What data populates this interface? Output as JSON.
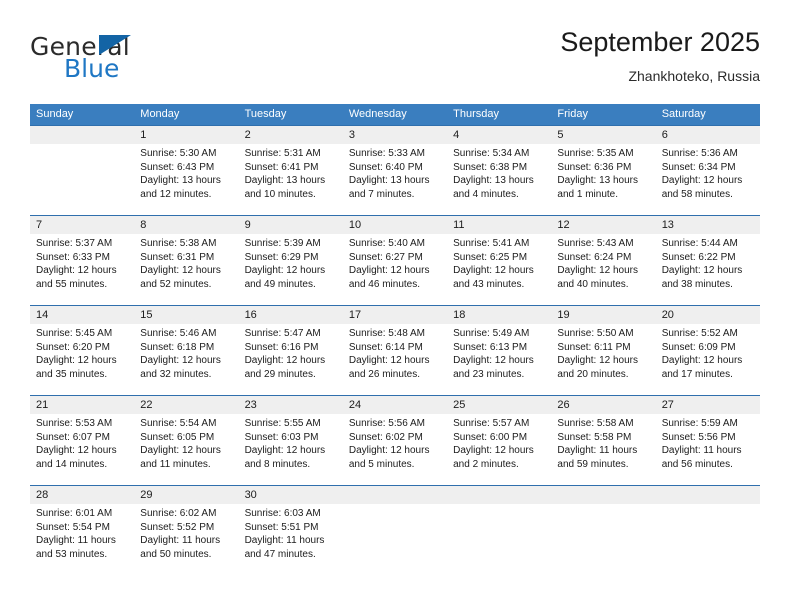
{
  "brand": {
    "name_part1": "General",
    "name_part2": "Blue",
    "triangle_color": "#1364a5",
    "blue_color": "#1f77c4"
  },
  "header": {
    "title": "September 2025",
    "subtitle": "Zhankhoteko, Russia"
  },
  "theme": {
    "header_blue": "#3a7ebf",
    "rule_blue": "#2f6fad",
    "band_gray": "#efefef"
  },
  "weekdays": [
    "Sunday",
    "Monday",
    "Tuesday",
    "Wednesday",
    "Thursday",
    "Friday",
    "Saturday"
  ],
  "weeks": [
    [
      {
        "day": "",
        "sunrise": "",
        "sunset": "",
        "daylight1": "",
        "daylight2": ""
      },
      {
        "day": "1",
        "sunrise": "Sunrise: 5:30 AM",
        "sunset": "Sunset: 6:43 PM",
        "daylight1": "Daylight: 13 hours",
        "daylight2": "and 12 minutes."
      },
      {
        "day": "2",
        "sunrise": "Sunrise: 5:31 AM",
        "sunset": "Sunset: 6:41 PM",
        "daylight1": "Daylight: 13 hours",
        "daylight2": "and 10 minutes."
      },
      {
        "day": "3",
        "sunrise": "Sunrise: 5:33 AM",
        "sunset": "Sunset: 6:40 PM",
        "daylight1": "Daylight: 13 hours",
        "daylight2": "and 7 minutes."
      },
      {
        "day": "4",
        "sunrise": "Sunrise: 5:34 AM",
        "sunset": "Sunset: 6:38 PM",
        "daylight1": "Daylight: 13 hours",
        "daylight2": "and 4 minutes."
      },
      {
        "day": "5",
        "sunrise": "Sunrise: 5:35 AM",
        "sunset": "Sunset: 6:36 PM",
        "daylight1": "Daylight: 13 hours",
        "daylight2": "and 1 minute."
      },
      {
        "day": "6",
        "sunrise": "Sunrise: 5:36 AM",
        "sunset": "Sunset: 6:34 PM",
        "daylight1": "Daylight: 12 hours",
        "daylight2": "and 58 minutes."
      }
    ],
    [
      {
        "day": "7",
        "sunrise": "Sunrise: 5:37 AM",
        "sunset": "Sunset: 6:33 PM",
        "daylight1": "Daylight: 12 hours",
        "daylight2": "and 55 minutes."
      },
      {
        "day": "8",
        "sunrise": "Sunrise: 5:38 AM",
        "sunset": "Sunset: 6:31 PM",
        "daylight1": "Daylight: 12 hours",
        "daylight2": "and 52 minutes."
      },
      {
        "day": "9",
        "sunrise": "Sunrise: 5:39 AM",
        "sunset": "Sunset: 6:29 PM",
        "daylight1": "Daylight: 12 hours",
        "daylight2": "and 49 minutes."
      },
      {
        "day": "10",
        "sunrise": "Sunrise: 5:40 AM",
        "sunset": "Sunset: 6:27 PM",
        "daylight1": "Daylight: 12 hours",
        "daylight2": "and 46 minutes."
      },
      {
        "day": "11",
        "sunrise": "Sunrise: 5:41 AM",
        "sunset": "Sunset: 6:25 PM",
        "daylight1": "Daylight: 12 hours",
        "daylight2": "and 43 minutes."
      },
      {
        "day": "12",
        "sunrise": "Sunrise: 5:43 AM",
        "sunset": "Sunset: 6:24 PM",
        "daylight1": "Daylight: 12 hours",
        "daylight2": "and 40 minutes."
      },
      {
        "day": "13",
        "sunrise": "Sunrise: 5:44 AM",
        "sunset": "Sunset: 6:22 PM",
        "daylight1": "Daylight: 12 hours",
        "daylight2": "and 38 minutes."
      }
    ],
    [
      {
        "day": "14",
        "sunrise": "Sunrise: 5:45 AM",
        "sunset": "Sunset: 6:20 PM",
        "daylight1": "Daylight: 12 hours",
        "daylight2": "and 35 minutes."
      },
      {
        "day": "15",
        "sunrise": "Sunrise: 5:46 AM",
        "sunset": "Sunset: 6:18 PM",
        "daylight1": "Daylight: 12 hours",
        "daylight2": "and 32 minutes."
      },
      {
        "day": "16",
        "sunrise": "Sunrise: 5:47 AM",
        "sunset": "Sunset: 6:16 PM",
        "daylight1": "Daylight: 12 hours",
        "daylight2": "and 29 minutes."
      },
      {
        "day": "17",
        "sunrise": "Sunrise: 5:48 AM",
        "sunset": "Sunset: 6:14 PM",
        "daylight1": "Daylight: 12 hours",
        "daylight2": "and 26 minutes."
      },
      {
        "day": "18",
        "sunrise": "Sunrise: 5:49 AM",
        "sunset": "Sunset: 6:13 PM",
        "daylight1": "Daylight: 12 hours",
        "daylight2": "and 23 minutes."
      },
      {
        "day": "19",
        "sunrise": "Sunrise: 5:50 AM",
        "sunset": "Sunset: 6:11 PM",
        "daylight1": "Daylight: 12 hours",
        "daylight2": "and 20 minutes."
      },
      {
        "day": "20",
        "sunrise": "Sunrise: 5:52 AM",
        "sunset": "Sunset: 6:09 PM",
        "daylight1": "Daylight: 12 hours",
        "daylight2": "and 17 minutes."
      }
    ],
    [
      {
        "day": "21",
        "sunrise": "Sunrise: 5:53 AM",
        "sunset": "Sunset: 6:07 PM",
        "daylight1": "Daylight: 12 hours",
        "daylight2": "and 14 minutes."
      },
      {
        "day": "22",
        "sunrise": "Sunrise: 5:54 AM",
        "sunset": "Sunset: 6:05 PM",
        "daylight1": "Daylight: 12 hours",
        "daylight2": "and 11 minutes."
      },
      {
        "day": "23",
        "sunrise": "Sunrise: 5:55 AM",
        "sunset": "Sunset: 6:03 PM",
        "daylight1": "Daylight: 12 hours",
        "daylight2": "and 8 minutes."
      },
      {
        "day": "24",
        "sunrise": "Sunrise: 5:56 AM",
        "sunset": "Sunset: 6:02 PM",
        "daylight1": "Daylight: 12 hours",
        "daylight2": "and 5 minutes."
      },
      {
        "day": "25",
        "sunrise": "Sunrise: 5:57 AM",
        "sunset": "Sunset: 6:00 PM",
        "daylight1": "Daylight: 12 hours",
        "daylight2": "and 2 minutes."
      },
      {
        "day": "26",
        "sunrise": "Sunrise: 5:58 AM",
        "sunset": "Sunset: 5:58 PM",
        "daylight1": "Daylight: 11 hours",
        "daylight2": "and 59 minutes."
      },
      {
        "day": "27",
        "sunrise": "Sunrise: 5:59 AM",
        "sunset": "Sunset: 5:56 PM",
        "daylight1": "Daylight: 11 hours",
        "daylight2": "and 56 minutes."
      }
    ],
    [
      {
        "day": "28",
        "sunrise": "Sunrise: 6:01 AM",
        "sunset": "Sunset: 5:54 PM",
        "daylight1": "Daylight: 11 hours",
        "daylight2": "and 53 minutes."
      },
      {
        "day": "29",
        "sunrise": "Sunrise: 6:02 AM",
        "sunset": "Sunset: 5:52 PM",
        "daylight1": "Daylight: 11 hours",
        "daylight2": "and 50 minutes."
      },
      {
        "day": "30",
        "sunrise": "Sunrise: 6:03 AM",
        "sunset": "Sunset: 5:51 PM",
        "daylight1": "Daylight: 11 hours",
        "daylight2": "and 47 minutes."
      },
      {
        "day": "",
        "sunrise": "",
        "sunset": "",
        "daylight1": "",
        "daylight2": ""
      },
      {
        "day": "",
        "sunrise": "",
        "sunset": "",
        "daylight1": "",
        "daylight2": ""
      },
      {
        "day": "",
        "sunrise": "",
        "sunset": "",
        "daylight1": "",
        "daylight2": ""
      },
      {
        "day": "",
        "sunrise": "",
        "sunset": "",
        "daylight1": "",
        "daylight2": ""
      }
    ]
  ]
}
